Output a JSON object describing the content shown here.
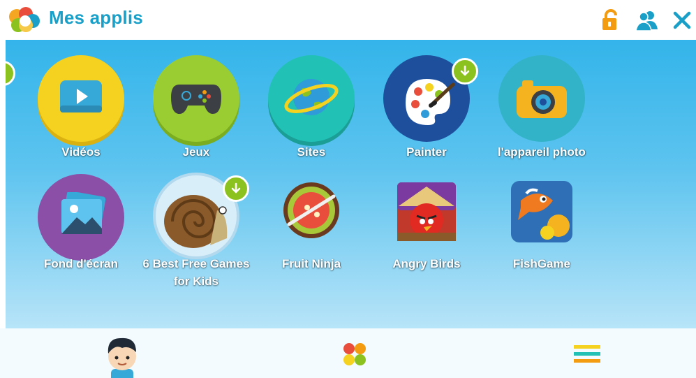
{
  "header": {
    "title": "Mes applis"
  },
  "apps_row1": [
    {
      "label": "Vidéos",
      "icon": "video-play-icon"
    },
    {
      "label": "Jeux",
      "icon": "gamepad-icon"
    },
    {
      "label": "Sites",
      "icon": "globe-icon"
    },
    {
      "label": "Painter",
      "icon": "paint-palette-icon",
      "download": true
    },
    {
      "label": "l'appareil photo",
      "icon": "camera-icon"
    }
  ],
  "apps_row2": [
    {
      "label": "Fond d'écran",
      "icon": "wallpaper-icon"
    },
    {
      "label_line1": "6 Best Free Games",
      "label_line2": "for Kids",
      "icon": "snail-icon",
      "download": true
    },
    {
      "label": "Fruit Ninja",
      "icon": "fruit-ninja-icon"
    },
    {
      "label": "Angry Birds",
      "icon": "angry-birds-icon"
    },
    {
      "label": "FishGame",
      "icon": "fish-game-icon"
    }
  ],
  "colors": {
    "title": "#1aa0c8",
    "accent_orange": "#f39c12",
    "badge_green": "#8cc21f",
    "background_top": "#33b4ea"
  }
}
